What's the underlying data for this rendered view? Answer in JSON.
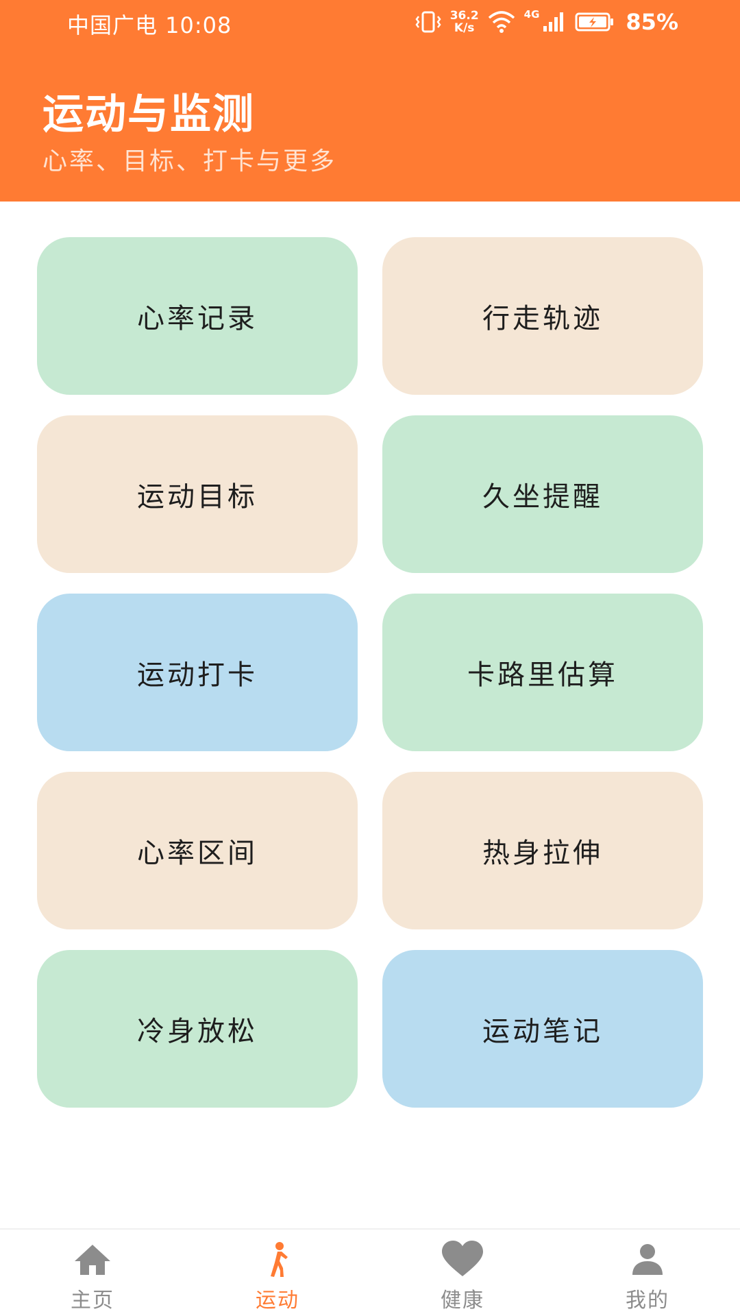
{
  "status_bar": {
    "carrier_time": "中国广电 10:08",
    "net_speed_value": "36.2",
    "net_speed_unit": "K/s",
    "network_label": "4G",
    "battery": "85%"
  },
  "header": {
    "title": "运动与监测",
    "subtitle": "心率、目标、打卡与更多"
  },
  "colors": {
    "accent": "#FF7B33",
    "card_green": "#C6E9D2",
    "card_beige": "#F5E6D5",
    "card_blue": "#B8DCF0",
    "nav_inactive": "#8c8c8c"
  },
  "cards": [
    {
      "label": "心率记录",
      "color": "green"
    },
    {
      "label": "行走轨迹",
      "color": "beige"
    },
    {
      "label": "运动目标",
      "color": "beige"
    },
    {
      "label": "久坐提醒",
      "color": "green"
    },
    {
      "label": "运动打卡",
      "color": "blue"
    },
    {
      "label": "卡路里估算",
      "color": "green"
    },
    {
      "label": "心率区间",
      "color": "beige"
    },
    {
      "label": "热身拉伸",
      "color": "beige"
    },
    {
      "label": "冷身放松",
      "color": "green"
    },
    {
      "label": "运动笔记",
      "color": "blue"
    }
  ],
  "bottom_nav": [
    {
      "label": "主页",
      "icon": "home-icon",
      "active": false
    },
    {
      "label": "运动",
      "icon": "running-icon",
      "active": true
    },
    {
      "label": "健康",
      "icon": "heart-icon",
      "active": false
    },
    {
      "label": "我的",
      "icon": "person-icon",
      "active": false
    }
  ]
}
